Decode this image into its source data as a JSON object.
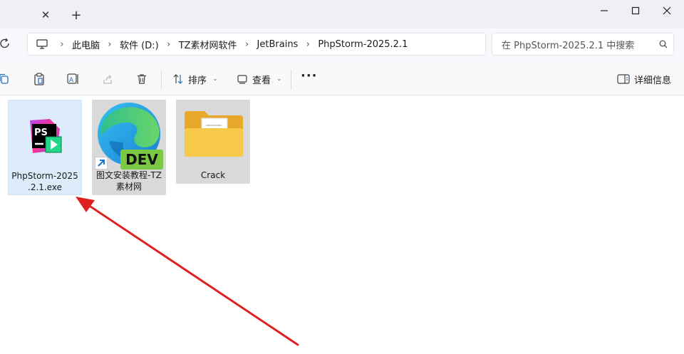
{
  "window": {
    "tab_close_glyph": "✕",
    "tab_new_glyph": "+"
  },
  "breadcrumb": {
    "items": [
      "此电脑",
      "软件 (D:)",
      "TZ素材网软件",
      "JetBrains",
      "PhpStorm-2025.2.1"
    ],
    "separator": "›"
  },
  "search": {
    "placeholder": "在 PhpStorm-2025.2.1 中搜索"
  },
  "toolbar": {
    "sort_label": "排序",
    "view_label": "查看",
    "more_label": "···",
    "details_label": "详细信息"
  },
  "files": [
    {
      "label": "PhpStorm-2025.2.1.exe",
      "label_lines": [
        "PhpStorm-2025",
        ".2.1.exe"
      ],
      "icon": "phpstorm-app-icon",
      "selected": true
    },
    {
      "label": "图文安装教程-TZ素材网",
      "label_lines": [
        "图文安装教程-TZ",
        "素材网"
      ],
      "icon": "edge-dev-shortcut-icon",
      "badge": "DEV"
    },
    {
      "label": "Crack",
      "label_lines": [
        "Crack"
      ],
      "icon": "folder-icon"
    }
  ],
  "colors": {
    "selection_bg": "#dcecfb",
    "arrow": "#e02020",
    "dev_badge": "#7ac943",
    "folder": "#f5c242"
  }
}
